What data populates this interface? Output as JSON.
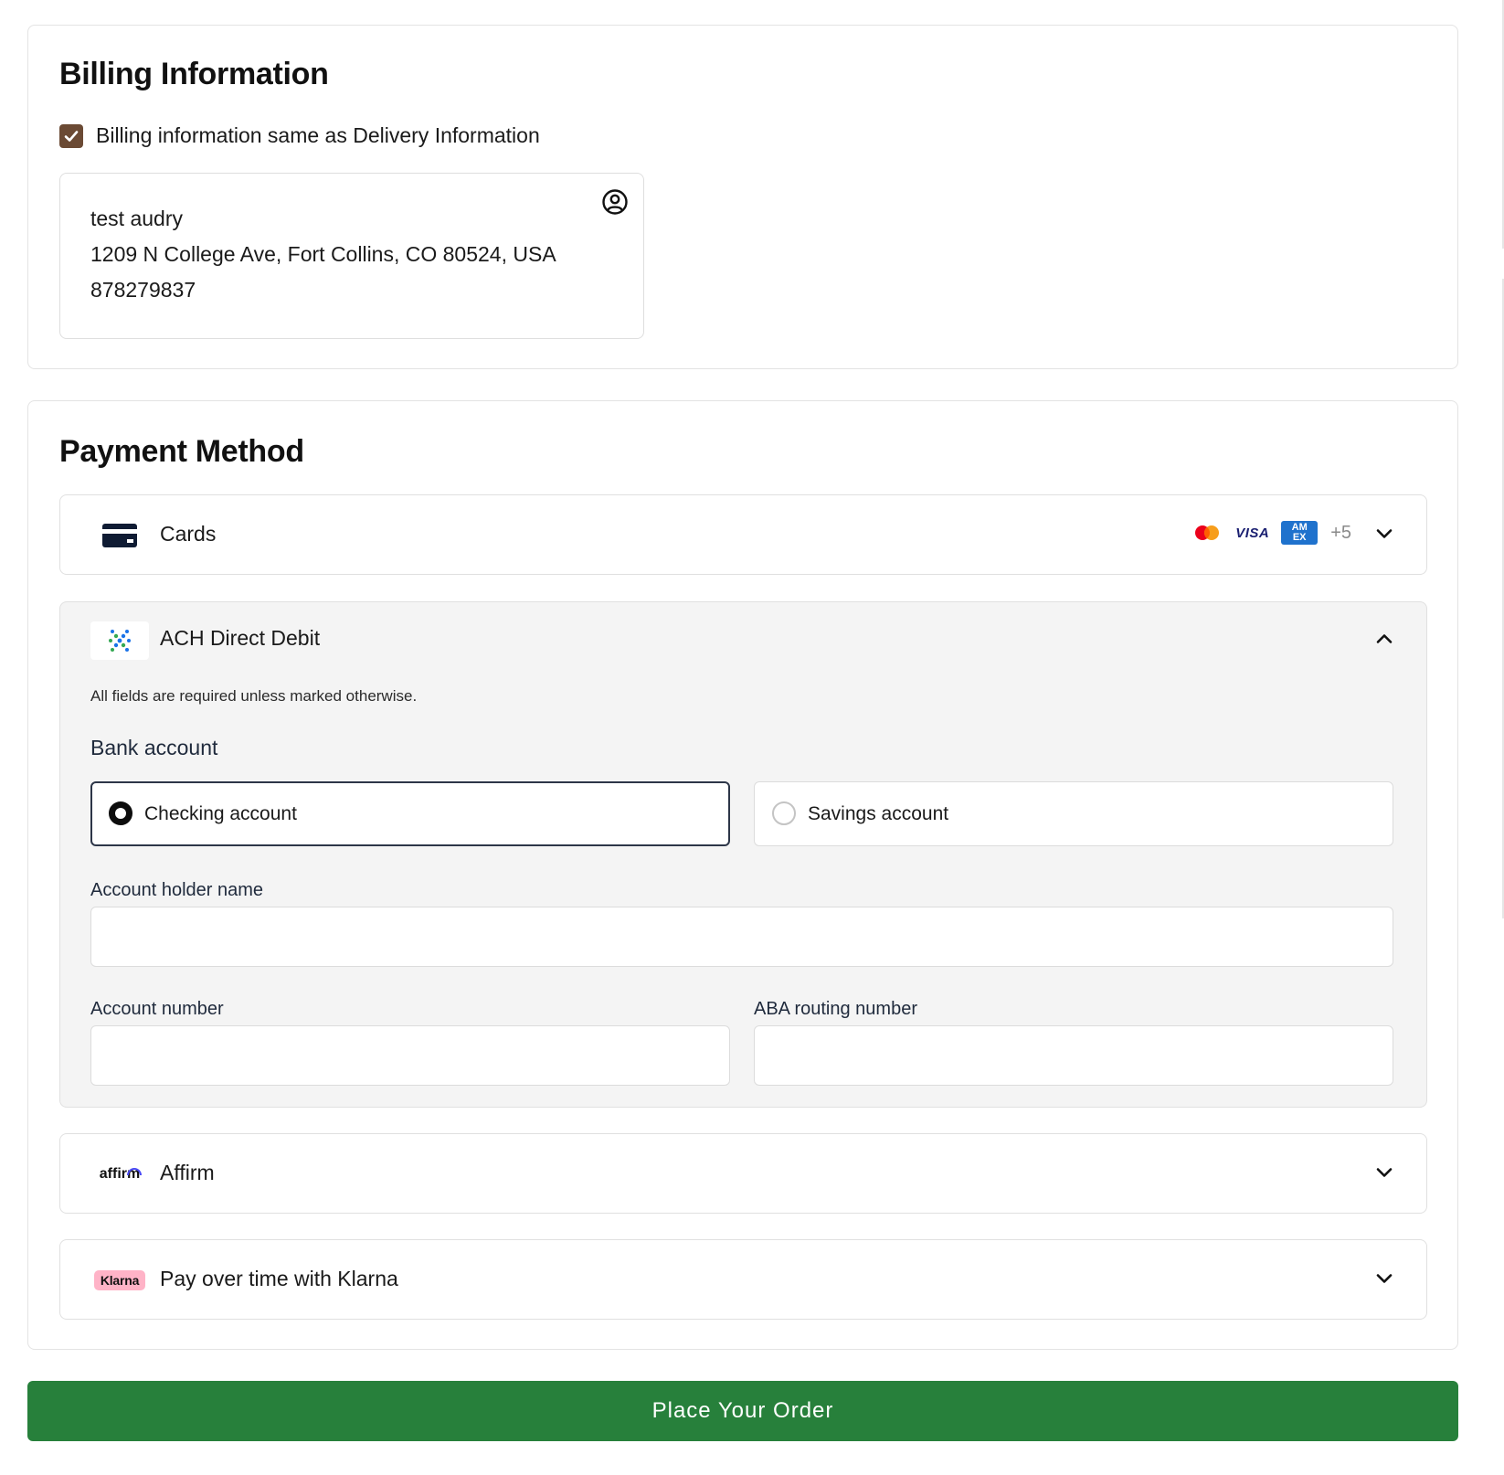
{
  "billing": {
    "title": "Billing Information",
    "same_as_delivery_label": "Billing information same as Delivery Information",
    "same_as_delivery_checked": true,
    "address": {
      "name": "test audry",
      "street": "1209 N College Ave, Fort Collins, CO 80524, USA",
      "phone": "878279837"
    }
  },
  "payment": {
    "title": "Payment Method",
    "cards": {
      "label": "Cards",
      "brands": {
        "visa": "VISA",
        "amex_top": "AM",
        "amex_bottom": "EX",
        "more": "+5"
      }
    },
    "ach": {
      "label": "ACH Direct Debit",
      "note": "All fields are required unless marked otherwise.",
      "bank_account_title": "Bank account",
      "checking_label": "Checking account",
      "savings_label": "Savings account",
      "selected_account_type": "Checking account",
      "holder_name_label": "Account holder name",
      "holder_name_value": "",
      "account_number_label": "Account number",
      "account_number_value": "",
      "routing_number_label": "ABA routing number",
      "routing_number_value": ""
    },
    "affirm": {
      "logo_text": "affirm",
      "label": "Affirm"
    },
    "klarna": {
      "logo_text": "Klarna",
      "label": "Pay over time with Klarna"
    }
  },
  "place_order_label": "Place Your Order",
  "colors": {
    "checkbox": "#6b4a34",
    "place_order_button": "#27803b",
    "ach_panel_bg": "#f4f4f4",
    "visa_blue": "#1a1f71",
    "amex_blue": "#1f72cd",
    "klarna_pink": "#ffb3c7"
  }
}
